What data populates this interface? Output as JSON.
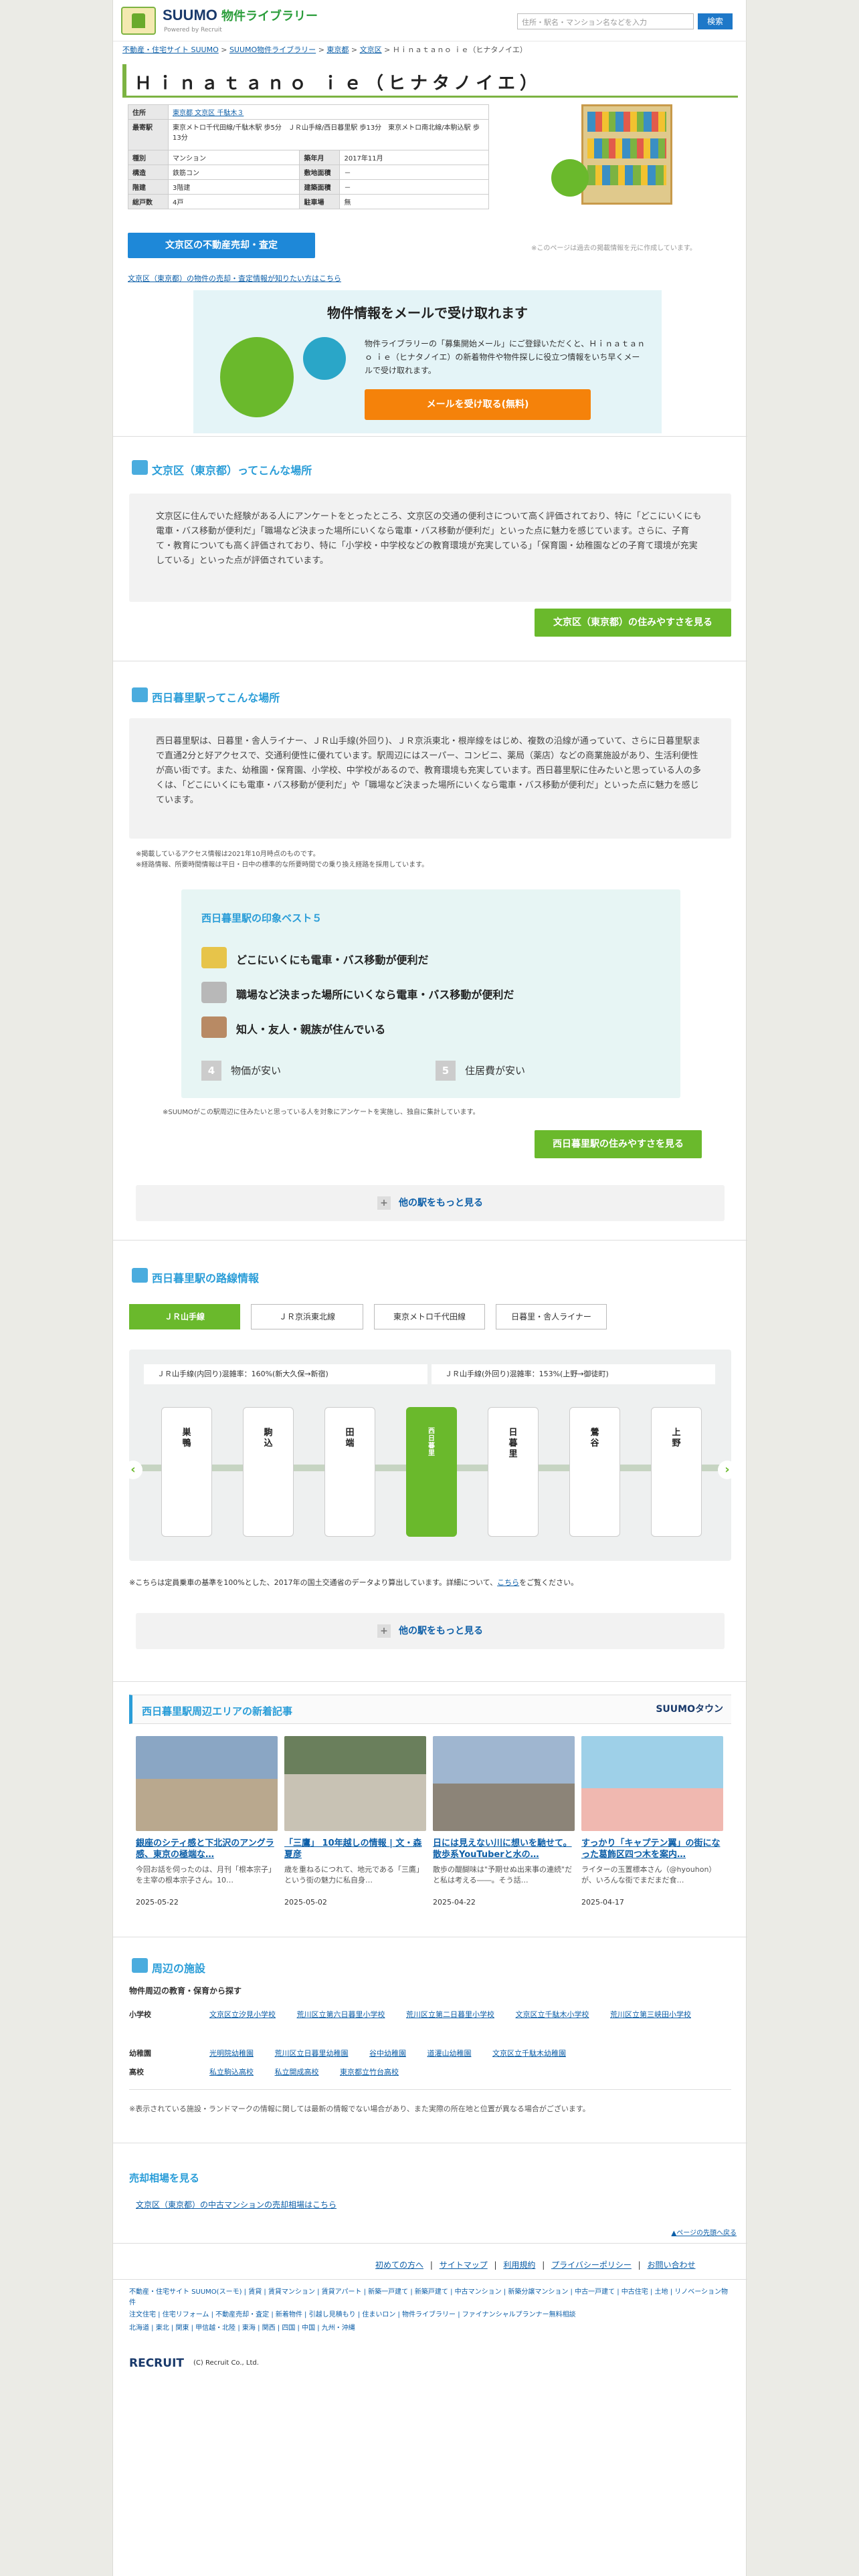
{
  "header": {
    "brand_main": "SUUMO",
    "brand_lib": "物件ライブラリー",
    "brand_sub": "Powered by Recruit",
    "search_placeholder": "住所・駅名・マンション名などを入力",
    "search_button": "検索"
  },
  "breadcrumb": [
    "不動産・住宅サイト SUUMO",
    "SUUMO物件ライブラリー",
    "東京都",
    "文京区",
    "Ｈｉｎａｔａｎｏ ｉｅ（ヒナタノイエ）"
  ],
  "breadcrumb_sep": ">",
  "property": {
    "name": "Ｈｉｎａｔａｎｏ ｉｅ（ヒナタノイエ）",
    "info": [
      {
        "k": "住所",
        "v": "東京都 文京区 千駄木３",
        "k2": "",
        "v2": ""
      },
      {
        "k": "最寄駅",
        "v": "東京メトロ千代田線/千駄木駅 歩5分　ＪＲ山手線/西日暮里駅 歩13分　東京メトロ南北線/本駒込駅 歩13分",
        "k2": "",
        "v2": ""
      },
      {
        "k": "種別",
        "v": "マンション",
        "k2": "築年月",
        "v2": "2017年11月"
      },
      {
        "k": "構造",
        "v": "鉄筋コン",
        "k2": "敷地面積",
        "v2": "－"
      },
      {
        "k": "階建",
        "v": "3階建",
        "k2": "建築面積",
        "v2": "－"
      },
      {
        "k": "総戸数",
        "v": "4戸",
        "k2": "駐車場",
        "v2": "無"
      }
    ],
    "sell_button": "文京区の不動産売却・査定",
    "note": "※このページは過去の掲載情報を元に作成しています。",
    "sell_link": "文京区（東京都）の物件の売却・査定情報が知りたい方はこちら"
  },
  "mail": {
    "title": "物件情報をメールで受け取れます",
    "text": "物件ライブラリーの「募集開始メール」にご登録いただくと、Ｈｉｎａｔａｎｏ ｉｅ（ヒナタノイエ）の新着物件や物件探しに役立つ情報をいち早くメールで受け取れます。",
    "button": "メールを受け取る(無料)"
  },
  "ward": {
    "heading": "文京区（東京都）ってこんな場所",
    "text": "文京区に住んでいた経験がある人にアンケートをとったところ、文京区の交通の便利さについて高く評価されており、特に「どこにいくにも電車・バス移動が便利だ」「職場など決まった場所にいくなら電車・バス移動が便利だ」といった点に魅力を感じています。さらに、子育て・教育についても高く評価されており、特に「小学校・中学校などの教育環境が充実している」「保育園・幼稚園などの子育て環境が充実している」といった点が評価されています。",
    "button": "文京区（東京都）の住みやすさを見る"
  },
  "station": {
    "heading": "西日暮里駅ってこんな場所",
    "text": "西日暮里駅は、日暮里・舎人ライナー、ＪＲ山手線(外回り)、ＪＲ京浜東北・根岸線をはじめ、複数の沿線が通っていて、さらに日暮里駅まで直通2分と好アクセスで、交通利便性に優れています。駅周辺にはスーパー、コンビニ、薬局（薬店）などの商業施設があり、生活利便性が高い街です。また、幼稚園・保育園、小学校、中学校があるので、教育環境も充実しています。西日暮里駅に住みたいと思っている人の多くは、「どこにいくにも電車・バス移動が便利だ」や「職場など決まった場所にいくなら電車・バス移動が便利だ」といった点に魅力を感じています。",
    "note1": "※掲載しているアクセス情報は2021年10月時点のものです。",
    "note2": "※経路情報、所要時間情報は平日・日中の標準的な所要時間での乗り換え経路を採用しています。",
    "best_title": "西日暮里駅の印象ベスト５",
    "best": [
      {
        "n": "1",
        "label": "どこにいくにも電車・バス移動が便利だ"
      },
      {
        "n": "2",
        "label": "職場など決まった場所にいくなら電車・バス移動が便利だ"
      },
      {
        "n": "3",
        "label": "知人・友人・親族が住んでいる"
      },
      {
        "n": "4",
        "label": "物価が安い"
      },
      {
        "n": "5",
        "label": "住居費が安い"
      }
    ],
    "best_note": "※SUUMOがこの駅周辺に住みたいと思っている人を対象にアンケートを実施し、独自に集計しています。",
    "button": "西日暮里駅の住みやすさを見る",
    "more": "他の駅をもっと見る"
  },
  "lines": {
    "heading": "西日暮里駅の路線情報",
    "tabs": [
      "ＪＲ山手線",
      "ＪＲ京浜東北線",
      "東京メトロ千代田線",
      "日暮里・舎人ライナー"
    ],
    "cong_left": "ＪＲ山手線(内回り)混雑率：160%(新大久保→新宿)",
    "cong_right": "ＪＲ山手線(外回り)混雑率：153%(上野→御徒町)",
    "stations": [
      "巣鴨",
      "駒込",
      "田端",
      "西日暮里",
      "日暮里",
      "鶯谷",
      "上野"
    ],
    "note": "※こちらは定員乗車の基準を100%とした、2017年の国土交通省のデータより算出しています。詳細について、",
    "note_link": "こちら",
    "note_tail": "をご覧ください。",
    "more": "他の駅をもっと見る"
  },
  "articles": {
    "heading": "西日暮里駅周辺エリアの新着記事",
    "logo": "SUUMOタウン",
    "items": [
      {
        "title": "銀座のシティ感と下北沢のアングラ感、東京の極端な…",
        "desc": "今回お話を伺ったのは、月刊「根本宗子」を主宰の根本宗子さん。10…",
        "date": "2025-05-22",
        "c1": "#8aa6c4",
        "c2": "#b9a88e"
      },
      {
        "title": "「三鷹」 10年越しの情報 | 文・森夏彦",
        "desc": "歳を重ねるにつれて、地元である「三鷹」という街の魅力に私自身…",
        "date": "2025-05-02",
        "c1": "#6a7f5c",
        "c2": "#c8c2b4"
      },
      {
        "title": "日には見えない川に想いを馳せて。散歩系YouTuberと水の…",
        "desc": "散歩の醍醐味は\"予期せぬ出来事の連続\"だと私は考える――。そう話…",
        "date": "2025-04-22",
        "c1": "#9fb6d0",
        "c2": "#8c8478"
      },
      {
        "title": "すっかり「キャプテン翼」の街になった葛飾区四つ木を案内…",
        "desc": "ライターの玉置標本さん（@hyouhon）が、いろんな街でまだまだ食…",
        "date": "2025-04-17",
        "c1": "#9ed0e8",
        "c2": "#f0b8b0"
      }
    ]
  },
  "facilities": {
    "heading": "周辺の施設",
    "sub": "物件周辺の教育・保育から探す",
    "rows": [
      {
        "k": "小学校",
        "items": [
          "文京区立汐見小学校",
          "荒川区立第六日暮里小学校",
          "荒川区立第二日暮里小学校",
          "文京区立千駄木小学校",
          "荒川区立第三峡田小学校"
        ]
      },
      {
        "k": "幼稚園",
        "items": [
          "光明院幼稚園",
          "荒川区立日暮里幼稚園",
          "谷中幼稚園",
          "道灌山幼稚園",
          "文京区立千駄木幼稚園"
        ]
      },
      {
        "k": "高校",
        "items": [
          "私立駒込高校",
          "私立開成高校",
          "東京都立竹台高校"
        ]
      }
    ],
    "note": "※表示されている施設・ランドマークの情報に関しては最新の情報でない場合があり、また実際の所在地と位置が異なる場合がございます。"
  },
  "price": {
    "heading": "売却相場を見る",
    "link": "文京区（東京都）の中古マンションの売却相場はこちら",
    "pagetop": "▲ページの先頭へ戻る"
  },
  "footer": {
    "top_links": [
      "初めての方へ",
      "サイトマップ",
      "利用規約",
      "プライバシーポリシー",
      "お問い合わせ"
    ],
    "line1": "不動産・住宅サイト SUUMO(スーモ) | 賃貸 | 賃貸マンション | 賃貸アパート | 新築一戸建て | 新築戸建て | 中古マンション | 新築分譲マンション | 中古一戸建て | 中古住宅 | 土地 | リノベーション物件",
    "line2": "注文住宅 | 住宅リフォーム | 不動産売却・査定 | 新着物件 | 引越し見積もり | 住まいロン | 物件ライブラリー | ファイナンシャルプランナー無料相談",
    "line3": "北海道 | 東北 | 関東 | 甲信越・北陸 | 東海 | 関西 | 四国 | 中国 | 九州・沖縄",
    "copyright": "(C) Recruit Co., Ltd.",
    "recruit": "RECRUIT"
  },
  "colors": {
    "green": "#6ab92c",
    "blue": "#2a9dd8",
    "orange": "#f5820a",
    "link": "#0d5fa8"
  }
}
